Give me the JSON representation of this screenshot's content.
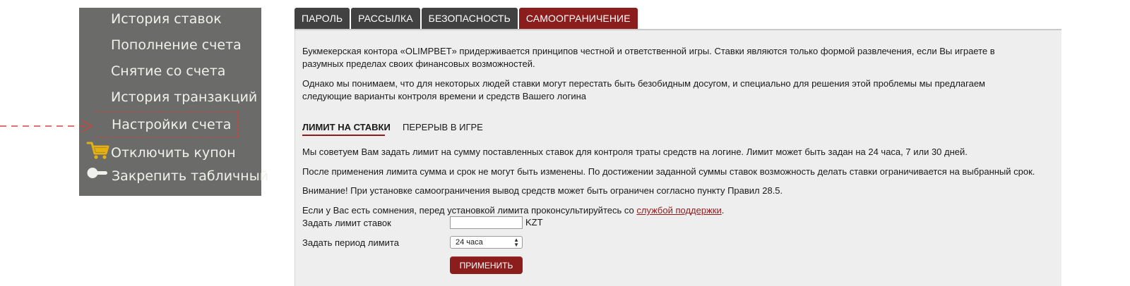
{
  "colors": {
    "menu_bg": "#6b6b69",
    "accent": "#8c1d1d",
    "tab_bg": "#414141",
    "panel_bg": "#eeeeee",
    "callout": "#c8463e"
  },
  "side_menu": {
    "items": [
      {
        "label": "История ставок",
        "icon": null
      },
      {
        "label": "Пополнение счета",
        "icon": null
      },
      {
        "label": "Снятие со счета",
        "icon": null
      },
      {
        "label": "История транзакций",
        "icon": null
      },
      {
        "label": "Настройки счета",
        "icon": null,
        "highlighted": true
      },
      {
        "label": "Отключить купон",
        "icon": "cart-icon"
      },
      {
        "label": "Закрепить табличный",
        "icon": "toggle-icon"
      }
    ]
  },
  "tabs": [
    {
      "label": "ПАРОЛЬ",
      "active": false
    },
    {
      "label": "РАССЫЛКА",
      "active": false
    },
    {
      "label": "БЕЗОПАСНОСТЬ",
      "active": false
    },
    {
      "label": "САМООГРАНИЧЕНИЕ",
      "active": true
    }
  ],
  "intro": {
    "p1": "Букмекерская контора «OLIMPBET» придерживается принципов честной и ответственной игры. Ставки являются только формой развлечения, если Вы играете в разумных пределах своих финансовых возможностей.",
    "p2": "Однако мы понимаем, что для некоторых людей ставки могут перестать быть безобидным досугом, и специально для решения этой проблемы мы предлагаем следующие варианты контроля времени и средств Вашего логина"
  },
  "subtabs": [
    {
      "label": "ЛИМИТ НА СТАВКИ",
      "active": true
    },
    {
      "label": "ПЕРЕРЫВ В ИГРЕ",
      "active": false
    }
  ],
  "limit": {
    "info1": "Мы советуем Вам задать лимит на сумму поставленных ставок для контроля траты средств на логине. Лимит может быть задан на 24 часа, 7 или 30 дней.",
    "info2": "После применения лимита сумма и срок не могут быть изменены. По достижении заданной суммы ставок возможность делать ставки ограничивается на выбранный срок.",
    "info3": "Внимание! При установке самоограничения вывод средств может быть ограничен согласно пункту Правил 28.5.",
    "info4_before": "Если у Вас есть сомнения, перед установкой лимита проконсультируйтесь со ",
    "info4_link": "службой поддержки",
    "info4_after": "."
  },
  "form": {
    "limit_label": "Задать лимит ставок",
    "limit_value": "",
    "currency": "KZT",
    "period_label": "Задать период лимита",
    "period_value": "24 часа",
    "apply_label": "ПРИМЕНИТЬ"
  }
}
